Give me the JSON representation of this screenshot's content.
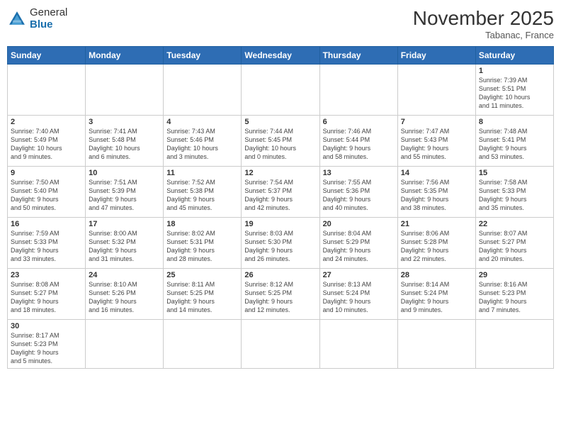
{
  "header": {
    "logo_general": "General",
    "logo_blue": "Blue",
    "month_title": "November 2025",
    "location": "Tabanac, France"
  },
  "days_of_week": [
    "Sunday",
    "Monday",
    "Tuesday",
    "Wednesday",
    "Thursday",
    "Friday",
    "Saturday"
  ],
  "weeks": [
    [
      {
        "day": "",
        "info": ""
      },
      {
        "day": "",
        "info": ""
      },
      {
        "day": "",
        "info": ""
      },
      {
        "day": "",
        "info": ""
      },
      {
        "day": "",
        "info": ""
      },
      {
        "day": "",
        "info": ""
      },
      {
        "day": "1",
        "info": "Sunrise: 7:39 AM\nSunset: 5:51 PM\nDaylight: 10 hours\nand 11 minutes."
      }
    ],
    [
      {
        "day": "2",
        "info": "Sunrise: 7:40 AM\nSunset: 5:49 PM\nDaylight: 10 hours\nand 9 minutes."
      },
      {
        "day": "3",
        "info": "Sunrise: 7:41 AM\nSunset: 5:48 PM\nDaylight: 10 hours\nand 6 minutes."
      },
      {
        "day": "4",
        "info": "Sunrise: 7:43 AM\nSunset: 5:46 PM\nDaylight: 10 hours\nand 3 minutes."
      },
      {
        "day": "5",
        "info": "Sunrise: 7:44 AM\nSunset: 5:45 PM\nDaylight: 10 hours\nand 0 minutes."
      },
      {
        "day": "6",
        "info": "Sunrise: 7:46 AM\nSunset: 5:44 PM\nDaylight: 9 hours\nand 58 minutes."
      },
      {
        "day": "7",
        "info": "Sunrise: 7:47 AM\nSunset: 5:43 PM\nDaylight: 9 hours\nand 55 minutes."
      },
      {
        "day": "8",
        "info": "Sunrise: 7:48 AM\nSunset: 5:41 PM\nDaylight: 9 hours\nand 53 minutes."
      }
    ],
    [
      {
        "day": "9",
        "info": "Sunrise: 7:50 AM\nSunset: 5:40 PM\nDaylight: 9 hours\nand 50 minutes."
      },
      {
        "day": "10",
        "info": "Sunrise: 7:51 AM\nSunset: 5:39 PM\nDaylight: 9 hours\nand 47 minutes."
      },
      {
        "day": "11",
        "info": "Sunrise: 7:52 AM\nSunset: 5:38 PM\nDaylight: 9 hours\nand 45 minutes."
      },
      {
        "day": "12",
        "info": "Sunrise: 7:54 AM\nSunset: 5:37 PM\nDaylight: 9 hours\nand 42 minutes."
      },
      {
        "day": "13",
        "info": "Sunrise: 7:55 AM\nSunset: 5:36 PM\nDaylight: 9 hours\nand 40 minutes."
      },
      {
        "day": "14",
        "info": "Sunrise: 7:56 AM\nSunset: 5:35 PM\nDaylight: 9 hours\nand 38 minutes."
      },
      {
        "day": "15",
        "info": "Sunrise: 7:58 AM\nSunset: 5:33 PM\nDaylight: 9 hours\nand 35 minutes."
      }
    ],
    [
      {
        "day": "16",
        "info": "Sunrise: 7:59 AM\nSunset: 5:33 PM\nDaylight: 9 hours\nand 33 minutes."
      },
      {
        "day": "17",
        "info": "Sunrise: 8:00 AM\nSunset: 5:32 PM\nDaylight: 9 hours\nand 31 minutes."
      },
      {
        "day": "18",
        "info": "Sunrise: 8:02 AM\nSunset: 5:31 PM\nDaylight: 9 hours\nand 28 minutes."
      },
      {
        "day": "19",
        "info": "Sunrise: 8:03 AM\nSunset: 5:30 PM\nDaylight: 9 hours\nand 26 minutes."
      },
      {
        "day": "20",
        "info": "Sunrise: 8:04 AM\nSunset: 5:29 PM\nDaylight: 9 hours\nand 24 minutes."
      },
      {
        "day": "21",
        "info": "Sunrise: 8:06 AM\nSunset: 5:28 PM\nDaylight: 9 hours\nand 22 minutes."
      },
      {
        "day": "22",
        "info": "Sunrise: 8:07 AM\nSunset: 5:27 PM\nDaylight: 9 hours\nand 20 minutes."
      }
    ],
    [
      {
        "day": "23",
        "info": "Sunrise: 8:08 AM\nSunset: 5:27 PM\nDaylight: 9 hours\nand 18 minutes."
      },
      {
        "day": "24",
        "info": "Sunrise: 8:10 AM\nSunset: 5:26 PM\nDaylight: 9 hours\nand 16 minutes."
      },
      {
        "day": "25",
        "info": "Sunrise: 8:11 AM\nSunset: 5:25 PM\nDaylight: 9 hours\nand 14 minutes."
      },
      {
        "day": "26",
        "info": "Sunrise: 8:12 AM\nSunset: 5:25 PM\nDaylight: 9 hours\nand 12 minutes."
      },
      {
        "day": "27",
        "info": "Sunrise: 8:13 AM\nSunset: 5:24 PM\nDaylight: 9 hours\nand 10 minutes."
      },
      {
        "day": "28",
        "info": "Sunrise: 8:14 AM\nSunset: 5:24 PM\nDaylight: 9 hours\nand 9 minutes."
      },
      {
        "day": "29",
        "info": "Sunrise: 8:16 AM\nSunset: 5:23 PM\nDaylight: 9 hours\nand 7 minutes."
      }
    ],
    [
      {
        "day": "30",
        "info": "Sunrise: 8:17 AM\nSunset: 5:23 PM\nDaylight: 9 hours\nand 5 minutes."
      },
      {
        "day": "",
        "info": ""
      },
      {
        "day": "",
        "info": ""
      },
      {
        "day": "",
        "info": ""
      },
      {
        "day": "",
        "info": ""
      },
      {
        "day": "",
        "info": ""
      },
      {
        "day": "",
        "info": ""
      }
    ]
  ]
}
